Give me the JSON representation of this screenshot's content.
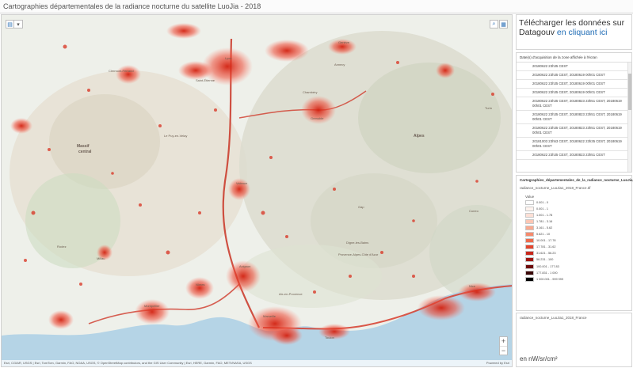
{
  "title": "Cartographies départementales de la radiance nocturne du satellite LuoJia - 2018",
  "download": {
    "text": "Télécharger les données sur Datagouv",
    "link": "en cliquant ici"
  },
  "dates": {
    "header": "Date(s) d'acquisition de la zone affichée à l'écran",
    "rows": [
      "20180622 23h35 CEST",
      "20180622 23h35 CEST, 20180619 00h01 CEST",
      "20180622 23h35 CEST, 20180619 00h01 CEST",
      "20180622 23h35 CEST, 20180619 00h01 CEST",
      "20180622 23h35 CEST, 20180823 23h51 CEST, 20180619 00h01 CEST",
      "20180622 23h35 CEST, 20180823 23h51 CEST, 20180619 00h01 CEST",
      "20180622 23h35 CEST, 20180823 23h51 CEST, 20180619 00h01 CEST",
      "20181003 23h53 CEST, 20180622 23h35 CEST, 20180619 00h01 CEST",
      "20180622 23h35 CEST, 20180823 23h51 CEST"
    ]
  },
  "legend": {
    "layer_title": "Cartographies_départementales_de_la_radiance_nocturne_LuoJia_2018_WTLY",
    "file": "radiance_nocturne_LuoJia1_2018_France.tif",
    "value_label": "Value",
    "items": [
      {
        "label": "0.001 - 0",
        "color": "#ffffff"
      },
      {
        "label": "0.001 - 1",
        "color": "#fff3ee"
      },
      {
        "label": "1.001 - 1.78",
        "color": "#fde0d6"
      },
      {
        "label": "1.781 - 3.16",
        "color": "#fbc6b4"
      },
      {
        "label": "3.161 - 5.62",
        "color": "#f9a98f"
      },
      {
        "label": "5.621 - 10",
        "color": "#f58a6d"
      },
      {
        "label": "10.001 - 17.78",
        "color": "#ee6a4c"
      },
      {
        "label": "17.781 - 31.62",
        "color": "#e3462f"
      },
      {
        "label": "31.621 - 56.23",
        "color": "#c8281c"
      },
      {
        "label": "56.231 - 100",
        "color": "#a01612"
      },
      {
        "label": "100.001 - 177.83",
        "color": "#6e0b0b"
      },
      {
        "label": "177.831 - 1 000",
        "color": "#3a0606"
      },
      {
        "label": "1 000.001 - 999 999",
        "color": "#000000"
      }
    ]
  },
  "unit_panel": {
    "layer_name": "radiance_nocturne_LuoJia1_2018_France",
    "unit": "en nW/sr/cm²"
  },
  "map": {
    "attribution_left": "Esri, CGIAR, USGS | Esri, TomTom, Garmin, FAO, NOAA, USGS, © OpenStreetMap contributors, and the GIS User Community | Esri, HERE, Garmin, FAO, METI/NASA, USGS",
    "attribution_right": "Powered by Esri",
    "zoom_in": "+",
    "zoom_out": "−",
    "places": [
      {
        "name": "Massif",
        "big": true
      },
      {
        "name": "central",
        "big": true
      },
      {
        "name": "Alpes",
        "big": true
      },
      {
        "name": "Provence-Alpes-Côte d'Azur",
        "big": false
      },
      {
        "name": "Lyon",
        "big": false
      },
      {
        "name": "Grenoble",
        "big": false
      },
      {
        "name": "Marseille",
        "big": false
      },
      {
        "name": "Toulon",
        "big": false
      },
      {
        "name": "Nice",
        "big": false
      },
      {
        "name": "Montpellier",
        "big": false
      },
      {
        "name": "Avignon",
        "big": false
      },
      {
        "name": "Nîmes",
        "big": false
      },
      {
        "name": "Valence",
        "big": false
      },
      {
        "name": "Clermont-Ferrand",
        "big": false
      },
      {
        "name": "Saint-Étienne",
        "big": false
      },
      {
        "name": "Genève",
        "big": false
      },
      {
        "name": "Turin",
        "big": false
      },
      {
        "name": "Cuneo",
        "big": false
      },
      {
        "name": "Gap",
        "big": false
      },
      {
        "name": "Digne-les-Bains",
        "big": false
      },
      {
        "name": "Aix-en-Provence",
        "big": false
      },
      {
        "name": "Rodez",
        "big": false
      },
      {
        "name": "Millau",
        "big": false
      },
      {
        "name": "Le Puy-en-Velay",
        "big": false
      },
      {
        "name": "Annecy",
        "big": false
      },
      {
        "name": "Chambéry",
        "big": false
      }
    ]
  }
}
